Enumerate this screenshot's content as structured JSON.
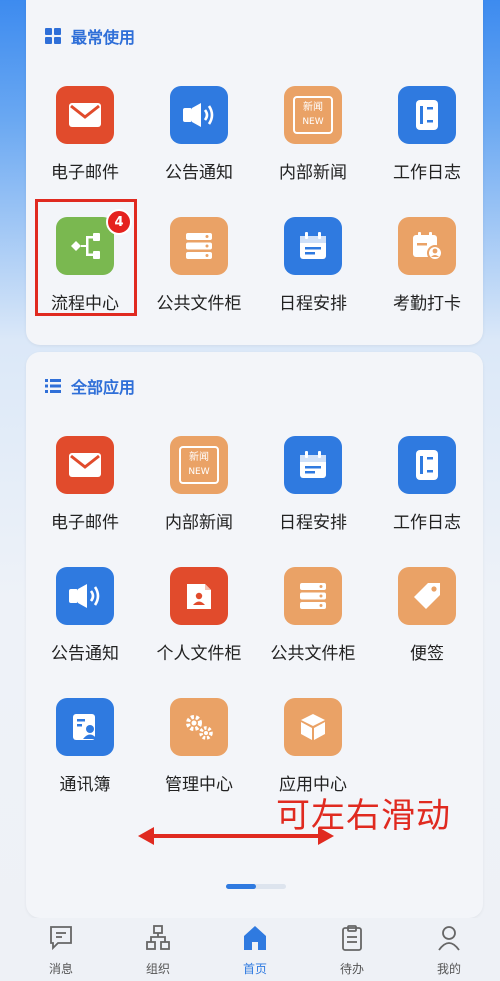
{
  "favorites": {
    "title": "最常使用",
    "apps": [
      {
        "label": "电子邮件",
        "icon": "mail-icon",
        "color": "#e14b2c"
      },
      {
        "label": "公告通知",
        "icon": "speaker-icon",
        "color": "#2f7ae0"
      },
      {
        "label": "内部新闻",
        "icon": "news-icon",
        "color": "#eaa266",
        "icon_text_1": "新闻",
        "icon_text_2": "NEW"
      },
      {
        "label": "工作日志",
        "icon": "notebook-icon",
        "color": "#2f7ae0"
      },
      {
        "label": "流程中心",
        "icon": "flow-icon",
        "color": "#7ab850",
        "badge": "4"
      },
      {
        "label": "公共文件柜",
        "icon": "cabinet-icon",
        "color": "#eaa266"
      },
      {
        "label": "日程安排",
        "icon": "calendar-icon",
        "color": "#2f7ae0"
      },
      {
        "label": "考勤打卡",
        "icon": "attendance-icon",
        "color": "#eaa266"
      }
    ]
  },
  "all_apps": {
    "title": "全部应用",
    "apps": [
      {
        "label": "电子邮件",
        "icon": "mail-icon",
        "color": "#e14b2c"
      },
      {
        "label": "内部新闻",
        "icon": "news-icon",
        "color": "#eaa266",
        "icon_text_1": "新闻",
        "icon_text_2": "NEW"
      },
      {
        "label": "日程安排",
        "icon": "calendar-icon",
        "color": "#2f7ae0"
      },
      {
        "label": "工作日志",
        "icon": "notebook-icon",
        "color": "#2f7ae0"
      },
      {
        "label": "公告通知",
        "icon": "speaker-icon",
        "color": "#2f7ae0"
      },
      {
        "label": "个人文件柜",
        "icon": "personal-folder-icon",
        "color": "#e14b2c"
      },
      {
        "label": "公共文件柜",
        "icon": "cabinet-icon",
        "color": "#eaa266"
      },
      {
        "label": "便签",
        "icon": "tag-icon",
        "color": "#eaa266"
      },
      {
        "label": "通讯簿",
        "icon": "contacts-icon",
        "color": "#2f7ae0"
      },
      {
        "label": "管理中心",
        "icon": "gears-icon",
        "color": "#eaa266"
      },
      {
        "label": "应用中心",
        "icon": "box-icon",
        "color": "#eaa266"
      }
    ]
  },
  "annotation": {
    "text": "可左右滑动",
    "color": "#e02a20"
  },
  "pager": {
    "current": 1,
    "total": 2
  },
  "tabbar": {
    "tabs": [
      {
        "label": "消息",
        "icon": "message-icon",
        "active": false
      },
      {
        "label": "组织",
        "icon": "organization-icon",
        "active": false
      },
      {
        "label": "首页",
        "icon": "home-icon",
        "active": true
      },
      {
        "label": "待办",
        "icon": "clipboard-icon",
        "active": false
      },
      {
        "label": "我的",
        "icon": "user-icon",
        "active": false
      }
    ]
  },
  "colors": {
    "accent": "#2f7ae0",
    "red": "#e14b2c",
    "orange": "#eaa266",
    "green": "#7ab850",
    "highlight": "#e02a20"
  }
}
